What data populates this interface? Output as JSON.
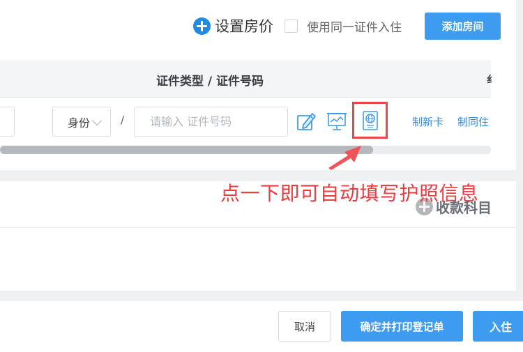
{
  "header": {
    "set_price_label": "设置房价",
    "same_id_label": "使用同一证件入住",
    "add_room_label": "添加房间"
  },
  "table": {
    "column_title": "证件类型 / 证件号码",
    "column_edge": "纟",
    "row": {
      "id_type_value": "身份",
      "separator": "/",
      "id_number_placeholder": "请输入 证件号码",
      "link_new_card": "制新卡",
      "link_same_stay": "制同住"
    },
    "scroll_position": 0.76
  },
  "annotation": {
    "text": "点一下即可自动填写护照信息",
    "color": "#ee3b3f"
  },
  "receipt": {
    "label": "收款科目"
  },
  "footer": {
    "cancel_label": "取消",
    "print_label": "确定并打印登记单",
    "checkin_label": "入住"
  },
  "colors": {
    "primary": "#3d9bf0",
    "link": "#2d8be6",
    "highlight_border": "#e8484b"
  },
  "icons": [
    "plus-circle-icon",
    "edit-icon",
    "screen-reader-icon",
    "passport-icon",
    "chevron-down-icon"
  ]
}
